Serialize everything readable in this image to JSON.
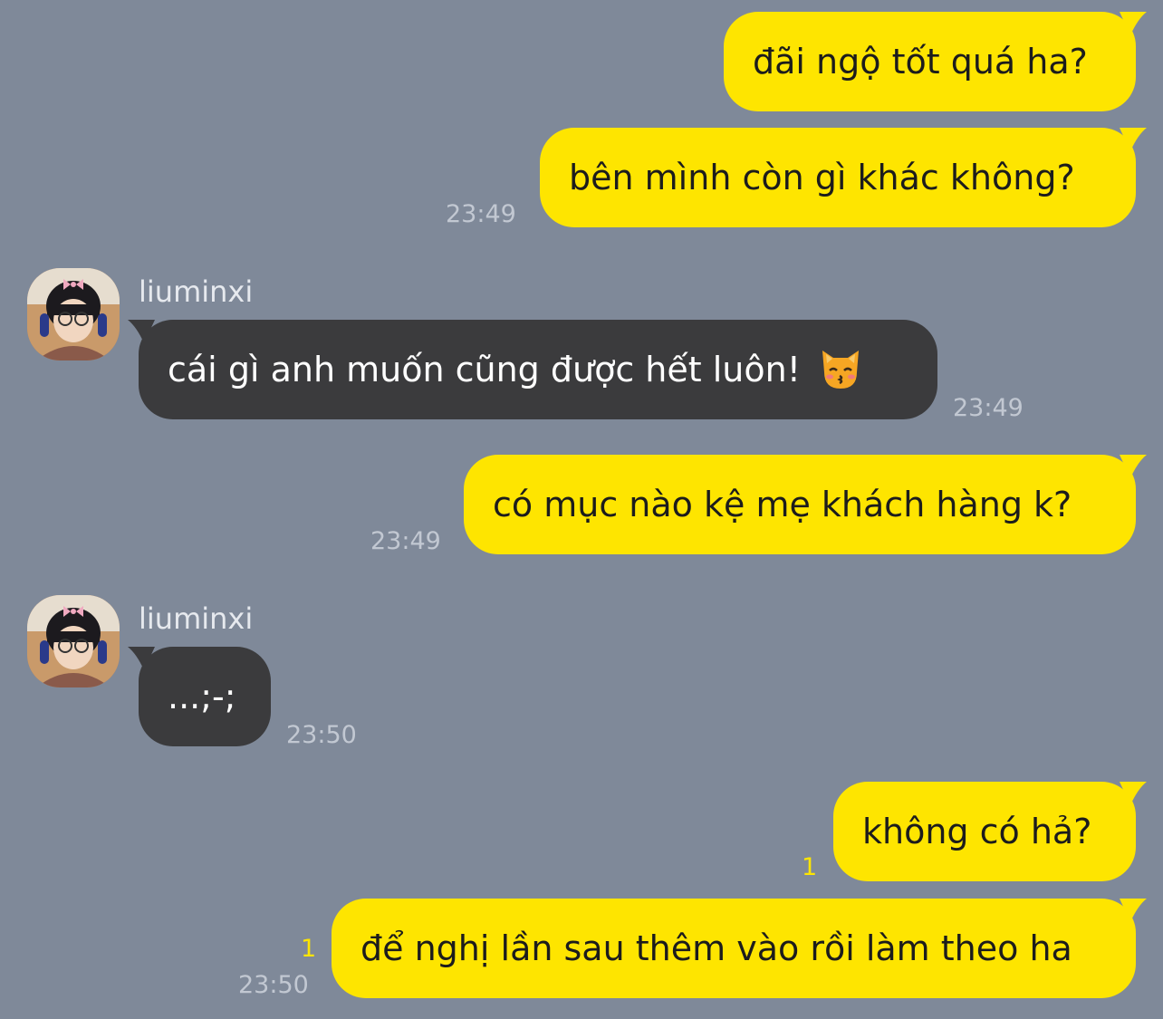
{
  "colors": {
    "background": "#7f8999",
    "outgoing_bubble": "#fee500",
    "incoming_bubble": "#3b3b3d",
    "unread_count": "#fee500"
  },
  "messages": [
    {
      "direction": "out",
      "text": "đãi ngộ tốt quá ha?"
    },
    {
      "direction": "out",
      "text": "bên mình còn gì khác không?",
      "time": "23:49"
    },
    {
      "direction": "in",
      "sender": "liuminxi",
      "text": "cái gì anh muốn cũng được hết luôn!",
      "emoji": "kissing-cat-emoji",
      "time": "23:49"
    },
    {
      "direction": "out",
      "text": "có mục nào kệ mẹ khách hàng k?",
      "time": "23:49"
    },
    {
      "direction": "in",
      "sender": "liuminxi",
      "text": "...;-;",
      "time": "23:50"
    },
    {
      "direction": "out",
      "text": "không có hả?",
      "unread": "1"
    },
    {
      "direction": "out",
      "text": "để nghị lần sau thêm vào rồi làm theo ha",
      "unread": "1",
      "time": "23:50"
    }
  ]
}
